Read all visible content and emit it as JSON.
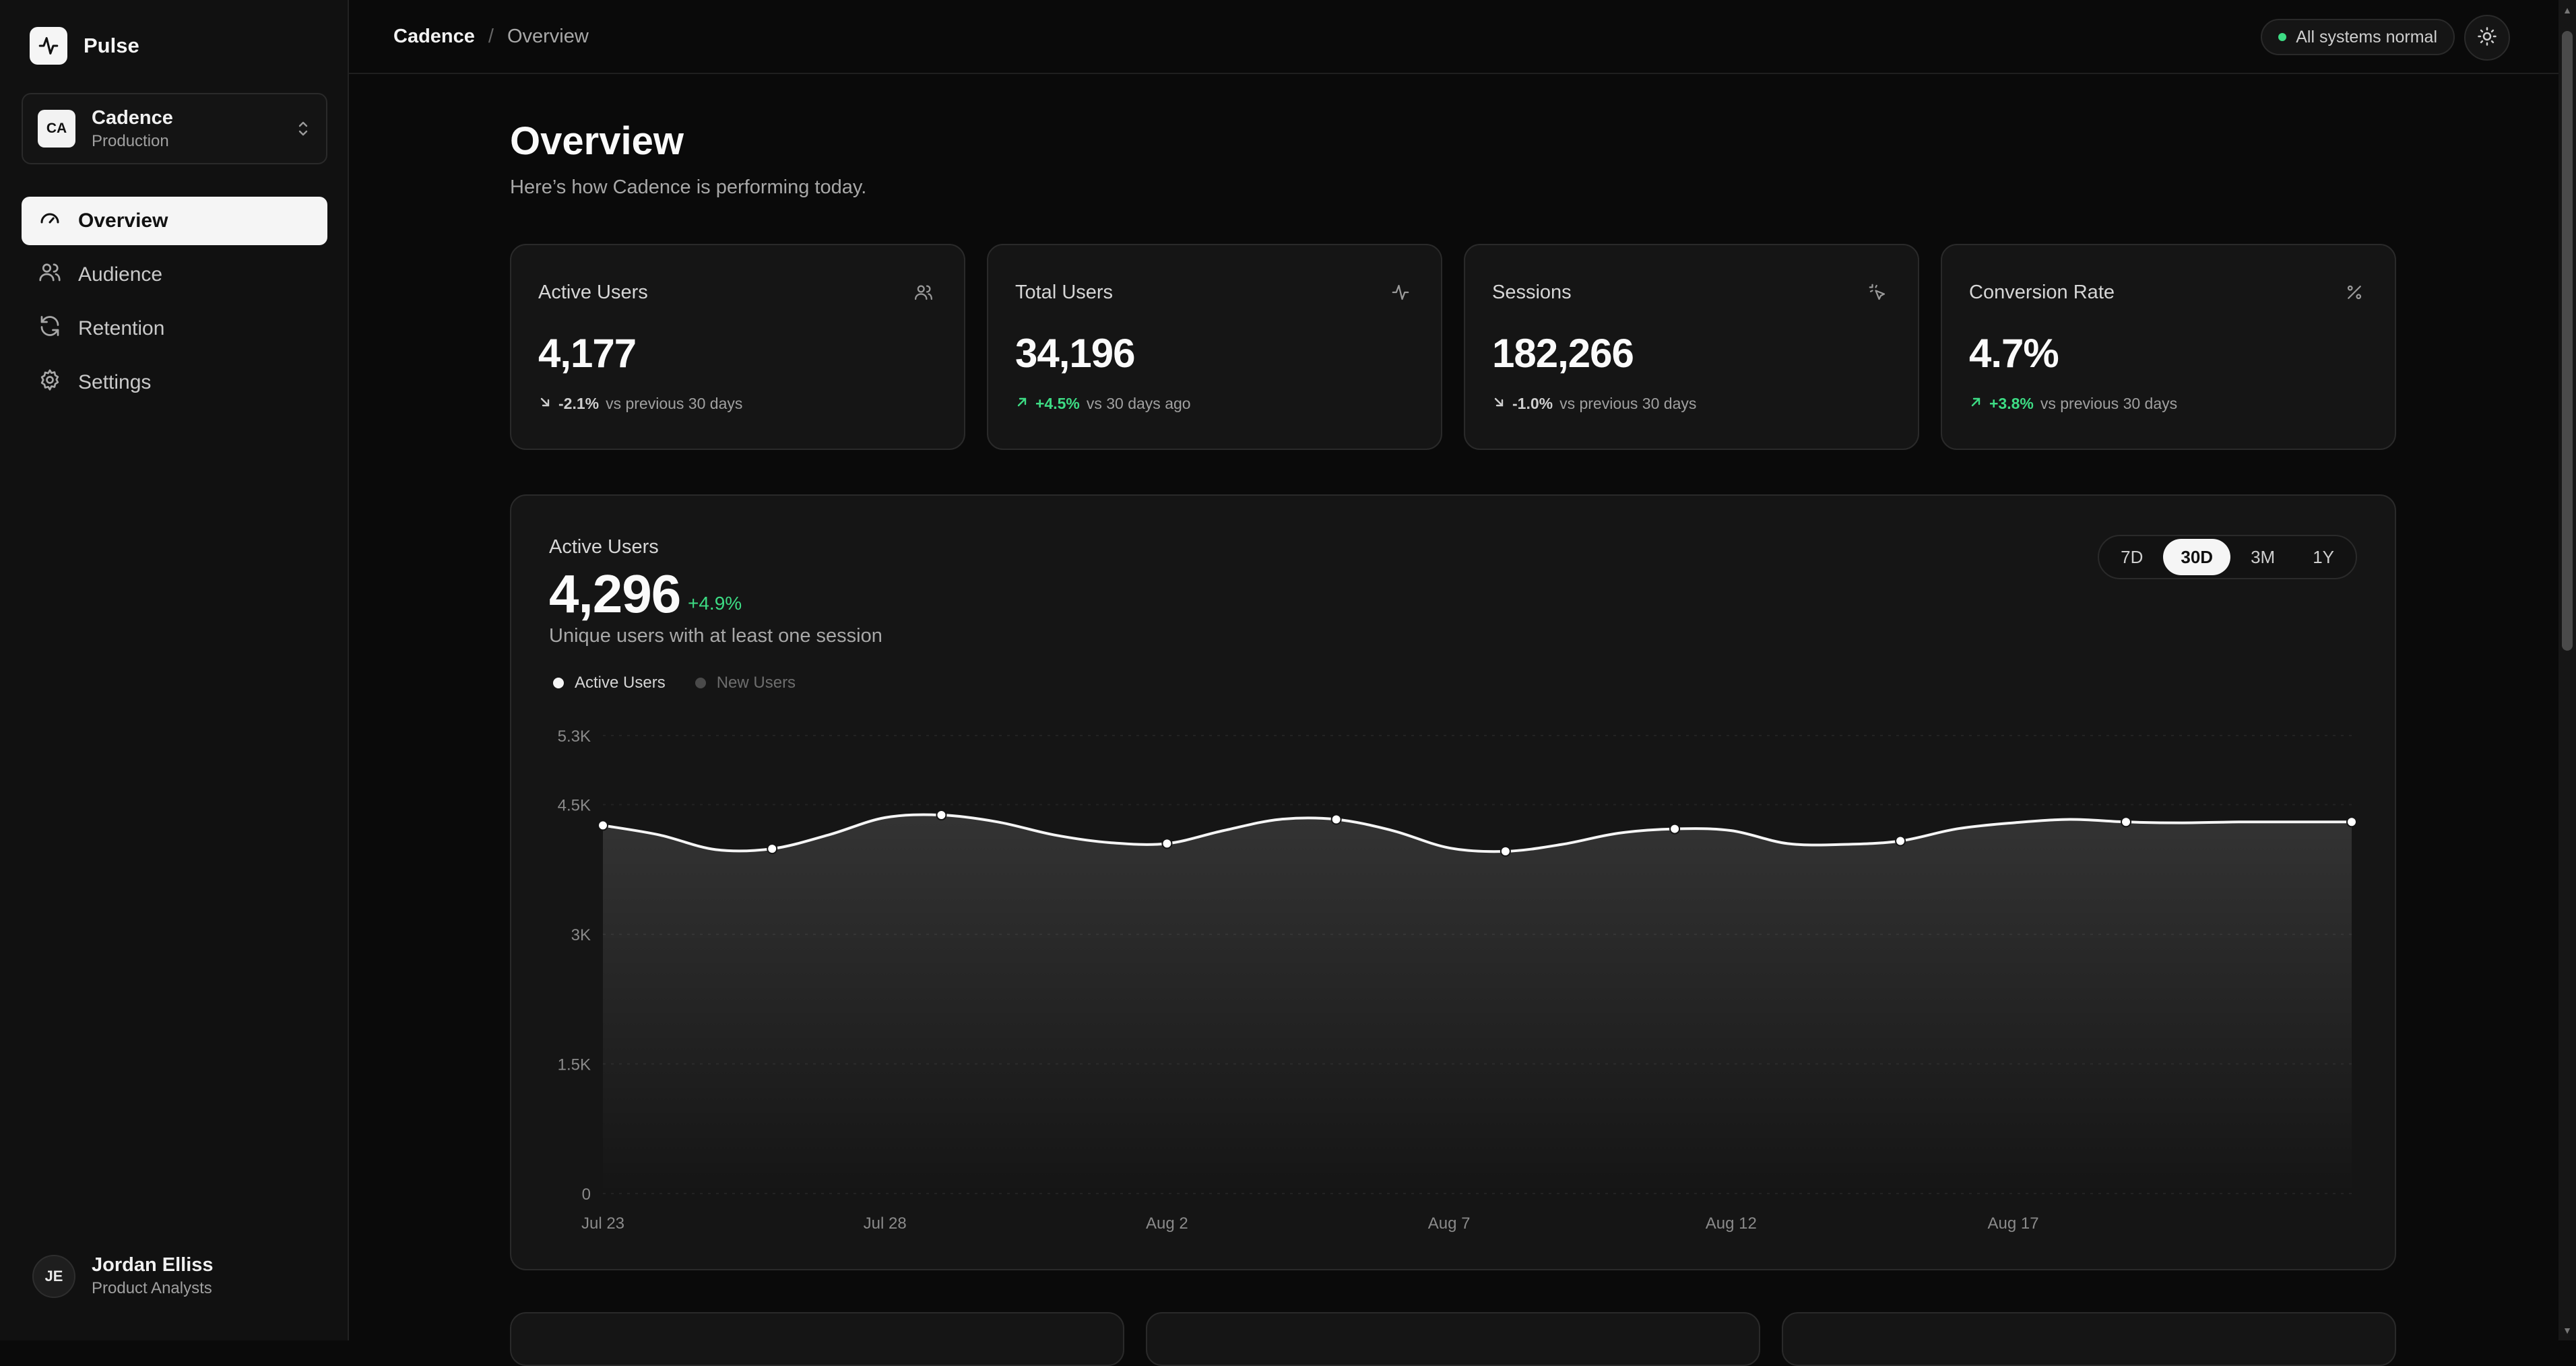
{
  "brand": {
    "name": "Pulse"
  },
  "org": {
    "initials": "CA",
    "name": "Cadence",
    "env": "Production"
  },
  "nav": [
    {
      "label": "Overview",
      "icon": "gauge-icon",
      "active": true
    },
    {
      "label": "Audience",
      "icon": "users-icon",
      "active": false
    },
    {
      "label": "Retention",
      "icon": "refresh-icon",
      "active": false
    },
    {
      "label": "Settings",
      "icon": "gear-icon",
      "active": false
    }
  ],
  "user": {
    "initials": "JE",
    "name": "Jordan Elliss",
    "role": "Product Analysts"
  },
  "topbar": {
    "crumb_root": "Cadence",
    "crumb_sep": "/",
    "crumb_current": "Overview",
    "status": "All systems normal",
    "status_color": "#3ddc84"
  },
  "page": {
    "title": "Overview",
    "subtitle": "Here’s how Cadence is performing today."
  },
  "kpis": [
    {
      "label": "Active Users",
      "icon": "users-icon",
      "value": "4,177",
      "direction": "down",
      "delta": "-2.1%",
      "note": "vs previous 30 days"
    },
    {
      "label": "Total Users",
      "icon": "pulse-icon",
      "value": "34,196",
      "direction": "up",
      "delta": "+4.5%",
      "note": "vs 30 days ago"
    },
    {
      "label": "Sessions",
      "icon": "cursor-click-icon",
      "value": "182,266",
      "direction": "down",
      "delta": "-1.0%",
      "note": "vs previous 30 days"
    },
    {
      "label": "Conversion Rate",
      "icon": "percent-icon",
      "value": "4.7%",
      "direction": "up",
      "delta": "+3.8%",
      "note": "vs previous 30 days"
    }
  ],
  "chart_card": {
    "label": "Active Users",
    "value": "4,296",
    "delta": "+4.9%",
    "description": "Unique users with at least one session",
    "ranges": [
      "7D",
      "30D",
      "3M",
      "1Y"
    ],
    "active_range": "30D"
  },
  "colors": {
    "accent_up": "#3ddc84",
    "line": "#f5f5f5",
    "legend_off": "#5a5a5a"
  },
  "chart_data": {
    "type": "area",
    "x": [
      "Jul 23",
      "Jul 24",
      "Jul 25",
      "Jul 26",
      "Jul 27",
      "Jul 28",
      "Jul 29",
      "Jul 30",
      "Jul 31",
      "Aug 1",
      "Aug 2",
      "Aug 3",
      "Aug 4",
      "Aug 5",
      "Aug 6",
      "Aug 7",
      "Aug 8",
      "Aug 9",
      "Aug 10",
      "Aug 11",
      "Aug 12",
      "Aug 13",
      "Aug 14",
      "Aug 15",
      "Aug 16",
      "Aug 17",
      "Aug 18",
      "Aug 19",
      "Aug 20",
      "Aug 21",
      "Aug 22",
      "Aug 23"
    ],
    "xticks": [
      "Jul 23",
      "Jul 28",
      "Aug 2",
      "Aug 7",
      "Aug 12",
      "Aug 17"
    ],
    "yticks": [
      "0",
      "1.5K",
      "3K",
      "4.5K",
      "5.3K"
    ],
    "ytick_values": [
      0,
      1500,
      3000,
      4500,
      5300
    ],
    "ylim": [
      0,
      5300
    ],
    "legend": [
      {
        "name": "Active Users",
        "visible": true
      },
      {
        "name": "New Users",
        "visible": false
      }
    ],
    "series": [
      {
        "name": "Active Users",
        "values": [
          4260,
          4150,
          3980,
          3990,
          4150,
          4350,
          4380,
          4300,
          4150,
          4060,
          4050,
          4200,
          4330,
          4330,
          4200,
          4000,
          3960,
          4040,
          4170,
          4220,
          4200,
          4050,
          4040,
          4080,
          4220,
          4290,
          4330,
          4300,
          4290,
          4300,
          4300,
          4300
        ]
      }
    ],
    "markers": [
      "Jul 23",
      "Jul 26",
      "Jul 29",
      "Aug 2",
      "Aug 5",
      "Aug 8",
      "Aug 11",
      "Aug 15",
      "Aug 19",
      "Aug 23"
    ]
  }
}
